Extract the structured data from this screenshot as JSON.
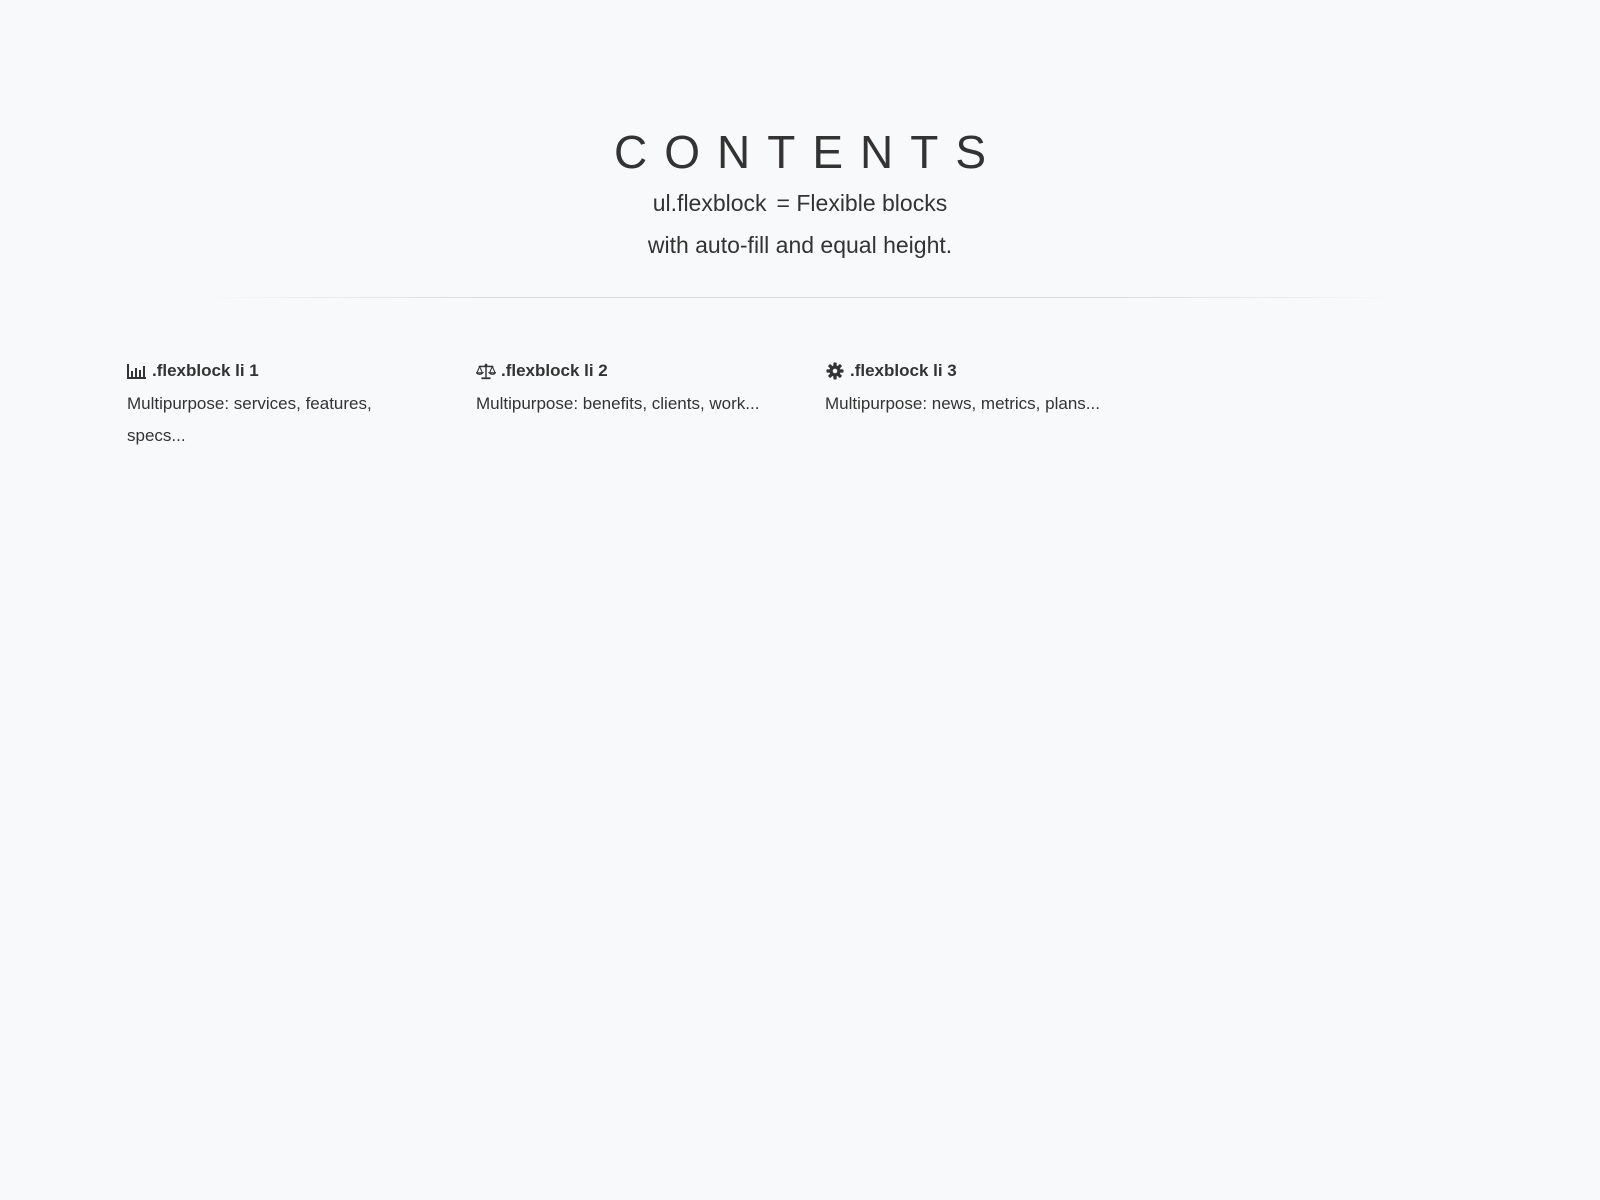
{
  "header": {
    "title": "CONTENTS",
    "subtitle_code": "ul.flexblock",
    "subtitle_rest": "= Flexible blocks",
    "subtitle_line2": "with auto-fill and equal height."
  },
  "blocks": [
    {
      "icon": "bar-chart-icon",
      "title": ".flexblock li 1",
      "description": "Multipurpose: services, features, specs..."
    },
    {
      "icon": "balance-scale-icon",
      "title": ".flexblock li 2",
      "description": "Multipurpose: benefits, clients, work..."
    },
    {
      "icon": "gear-icon",
      "title": ".flexblock li 3",
      "description": "Multipurpose: news, metrics, plans..."
    }
  ],
  "colors": {
    "background": "#f8f9fa",
    "text": "#333333"
  }
}
